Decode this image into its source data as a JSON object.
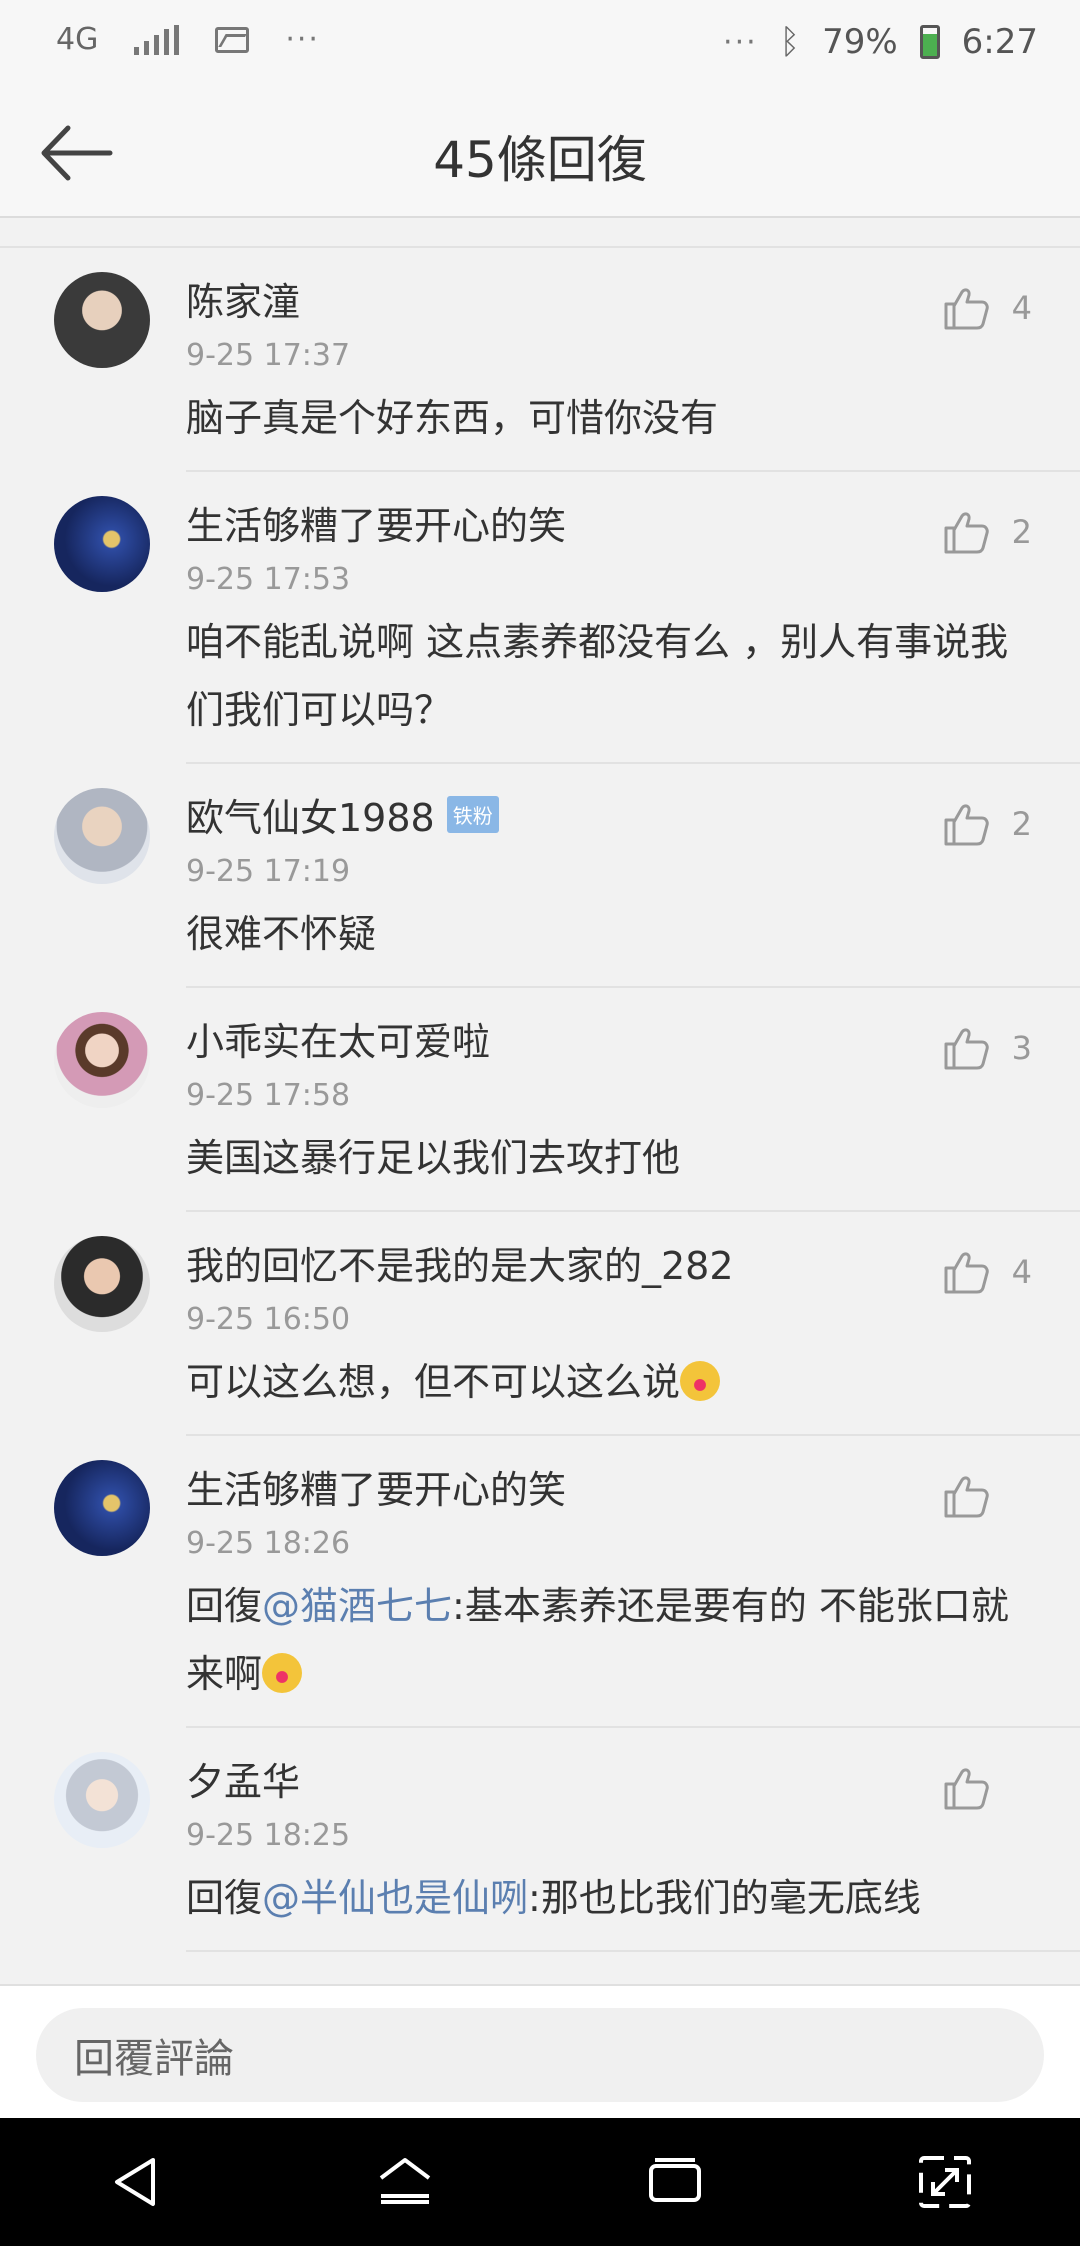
{
  "status_bar": {
    "network": "4G",
    "dots_left": "···",
    "dots_right": "···",
    "battery": "79%",
    "time": "6:27"
  },
  "header": {
    "title": "45條回復"
  },
  "comments": [
    {
      "username": "陈家潼",
      "time": "9-25 17:37",
      "text": "脑子真是个好东西，可惜你没有",
      "likes": "4",
      "avatar": "av-dark"
    },
    {
      "username": "生活够糟了要开心的笑",
      "time": "9-25 17:53",
      "text": "咱不能乱说啊 这点素养都没有么 ，别人有事说我们我们可以吗？",
      "likes": "2",
      "avatar": "av-night"
    },
    {
      "username": "欧气仙女1988",
      "badge": "铁粉",
      "time": "9-25 17:19",
      "text": "很难不怀疑",
      "likes": "2",
      "avatar": "av-light"
    },
    {
      "username": "小乖实在太可爱啦",
      "time": "9-25 17:58",
      "text": "美国这暴行足以我们去攻打他",
      "likes": "3",
      "avatar": "av-girl"
    },
    {
      "username": "我的回忆不是我的是大家的_282",
      "time": "9-25 16:50",
      "text": "可以这么想，但不可以这么说",
      "likes": "4",
      "avatar": "av-boy",
      "emoji": "crying-laugh"
    },
    {
      "username": "生活够糟了要开心的笑",
      "time": "9-25 18:26",
      "reply_prefix": "回復",
      "mention": "@猫酒七七",
      "text": ":基本素养还是要有的 不能张口就来啊",
      "likes": "",
      "avatar": "av-night",
      "emoji": "crying-laugh"
    },
    {
      "username": "夕孟华",
      "time": "9-25 18:25",
      "reply_prefix": "回復",
      "mention": "@半仙也是仙咧",
      "text": ":那也比我们的毫无底线",
      "likes": "",
      "avatar": "av-anime"
    }
  ],
  "reply_bar": {
    "placeholder": "回覆評論"
  },
  "icons": {
    "back": "arrow-left-icon",
    "like": "thumbs-up-icon",
    "nav_back": "triangle-back-icon",
    "nav_home": "home-icon",
    "nav_recents": "recents-icon",
    "nav_expand": "expand-icon"
  },
  "colors": {
    "mention": "#5b7fb0",
    "badge": "#8ab7e6",
    "background": "#f2f2f2"
  }
}
